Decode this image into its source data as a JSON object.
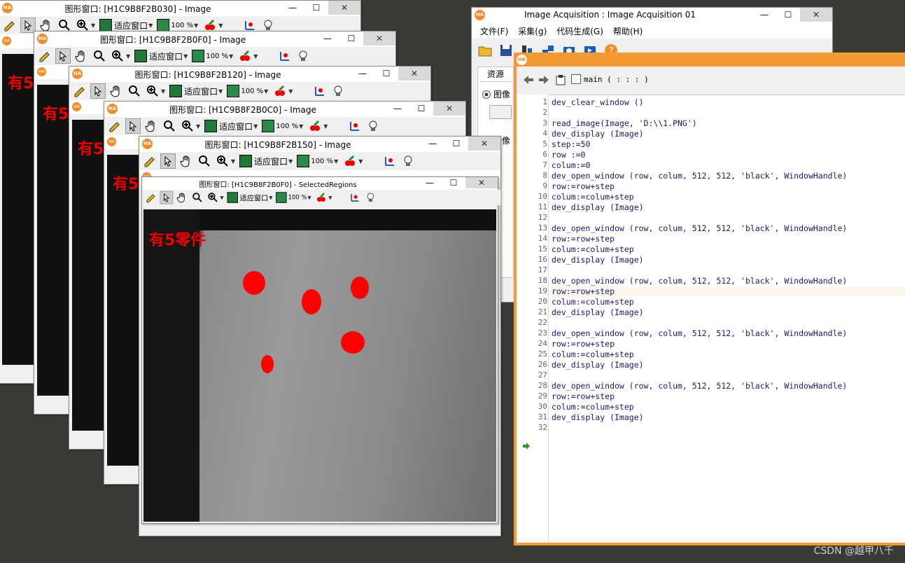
{
  "graphics_windows": [
    {
      "title": "图形窗口: [H1C9B8F2B030] - Image",
      "label": "有5",
      "zoom": "100 %",
      "fit_label": "适应窗口"
    },
    {
      "title": "图形窗口: [H1C9B8F2B0F0] - Image",
      "label": "有5",
      "zoom": "100 %",
      "fit_label": "适应窗口"
    },
    {
      "title": "图形窗口: [H1C9B8F2B120] - Image",
      "label": "有5",
      "zoom": "100 %",
      "fit_label": "适应窗口"
    },
    {
      "title": "图形窗口: [H1C9B8F2B0C0] - Image",
      "label": "有5",
      "zoom": "100 %",
      "fit_label": "适应窗口"
    },
    {
      "title": "图形窗口: [H1C9B8F2B150] - Image",
      "label": "有5",
      "zoom": "100 %",
      "fit_label": "适应窗口"
    }
  ],
  "front_window": {
    "title": "图形窗口: [H1C9B8F2B0F0] - SelectedRegions",
    "label": "有5零件",
    "zoom": "100 %",
    "fit_label": "适应窗口"
  },
  "acquisition": {
    "title": "Image Acquisition : Image Acquisition 01",
    "menu": [
      "文件(F)",
      "采集(g)",
      "代码生成(G)",
      "帮助(H)"
    ],
    "tab": "资源",
    "radio1": "图像",
    "radio2": "图像"
  },
  "editor": {
    "procedure": "main ( : : : )",
    "lines": [
      "dev_clear_window ()",
      "",
      "read_image(Image, 'D:\\\\1.PNG')",
      "dev_display (Image)",
      "step:=50",
      "row :=0",
      "colum:=0",
      "dev_open_window (row, colum, 512, 512, 'black', WindowHandle)",
      "row:=row+step",
      "colum:=colum+step",
      "dev_display (Image)",
      "",
      "dev_open_window (row, colum, 512, 512, 'black', WindowHandle)",
      "row:=row+step",
      "colum:=colum+step",
      "dev_display (Image)",
      "",
      "dev_open_window (row, colum, 512, 512, 'black', WindowHandle)",
      "row:=row+step",
      "colum:=colum+step",
      "dev_display (Image)",
      "",
      "dev_open_window (row, colum, 512, 512, 'black', WindowHandle)",
      "row:=row+step",
      "colum:=colum+step",
      "dev_display (Image)",
      "",
      "dev_open_window (row, colum, 512, 512, 'black', WindowHandle)",
      "row:=row+step",
      "colum:=colum+step",
      "dev_display (Image)",
      ""
    ],
    "active_line": 19
  },
  "watermark": "CSDN @越甲八千",
  "colors": {
    "editor_border": "#f39a32",
    "region": "#ff0000",
    "close_button": "#e81123"
  }
}
